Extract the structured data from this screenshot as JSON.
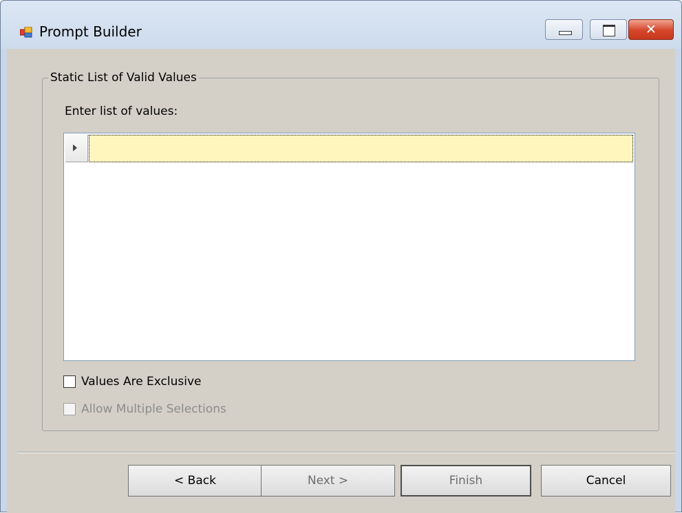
{
  "window": {
    "title": "Prompt Builder",
    "app_icon": "app-window-icon",
    "caption_buttons": {
      "minimize_icon": "minimize-icon",
      "maximize_icon": "maximize-icon",
      "close_icon": "close-icon",
      "close_glyph": "✕"
    }
  },
  "group": {
    "title": "Static List of Valid Values",
    "list_label": "Enter list of values:"
  },
  "grid": {
    "rows": [
      {
        "value": ""
      }
    ],
    "current_row_icon": "row-pointer-icon"
  },
  "options": {
    "values_exclusive": {
      "label": "Values Are Exclusive",
      "checked": false,
      "enabled": true
    },
    "allow_multiple": {
      "label": "Allow Multiple Selections",
      "checked": false,
      "enabled": false
    }
  },
  "buttons": {
    "back": "< Back",
    "next": "Next >",
    "finish": "Finish",
    "cancel": "Cancel"
  },
  "colors": {
    "client_background": "#d4d0c8",
    "selected_cell": "#fff6bd",
    "close_button": "#d6452a"
  }
}
